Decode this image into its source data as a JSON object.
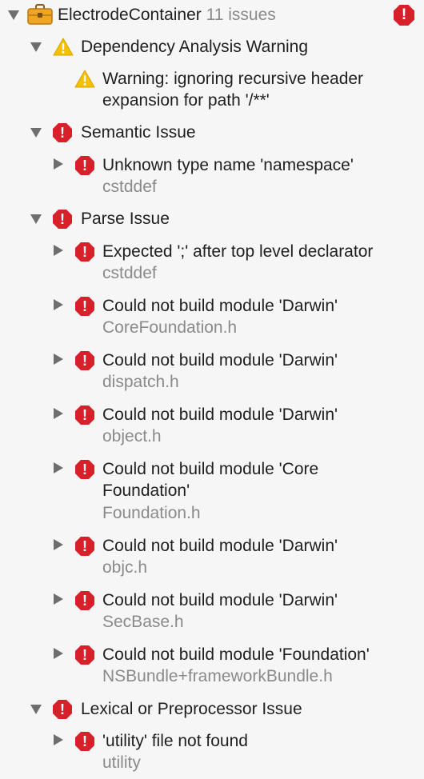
{
  "project": {
    "name": "ElectrodeContainer",
    "count_label": "11 issues",
    "error_glyph": "!"
  },
  "groups": {
    "dependency": {
      "title": "Dependency Analysis Warning",
      "item_line1": "Warning: ignoring recursive header",
      "item_line2": "expansion for path '/**'"
    },
    "semantic": {
      "title": "Semantic Issue",
      "item_title": "Unknown type name 'namespace'",
      "item_file": "cstddef"
    },
    "parse": {
      "title": "Parse Issue",
      "items": [
        {
          "title": "Expected ';' after top level declarator",
          "file": "cstddef"
        },
        {
          "title": "Could not build module 'Darwin'",
          "file": "CoreFoundation.h"
        },
        {
          "title": "Could not build module 'Darwin'",
          "file": "dispatch.h"
        },
        {
          "title": "Could not build module 'Darwin'",
          "file": "object.h"
        },
        {
          "title_line1": "Could not build module 'Core",
          "title_line2": "Foundation'",
          "file": "Foundation.h"
        },
        {
          "title": "Could not build module 'Darwin'",
          "file": "objc.h"
        },
        {
          "title": "Could not build module 'Darwin'",
          "file": "SecBase.h"
        },
        {
          "title": "Could not build module 'Foundation'",
          "file": "NSBundle+frameworkBundle.h"
        }
      ]
    },
    "lexical": {
      "title": "Lexical or Preprocessor Issue",
      "item_title": "'utility' file not found",
      "item_file": "utility"
    }
  },
  "colors": {
    "error": "#d8202b",
    "warning": "#f5c000",
    "secondary_text": "#8a8a8a",
    "background": "#f6f6f6"
  }
}
